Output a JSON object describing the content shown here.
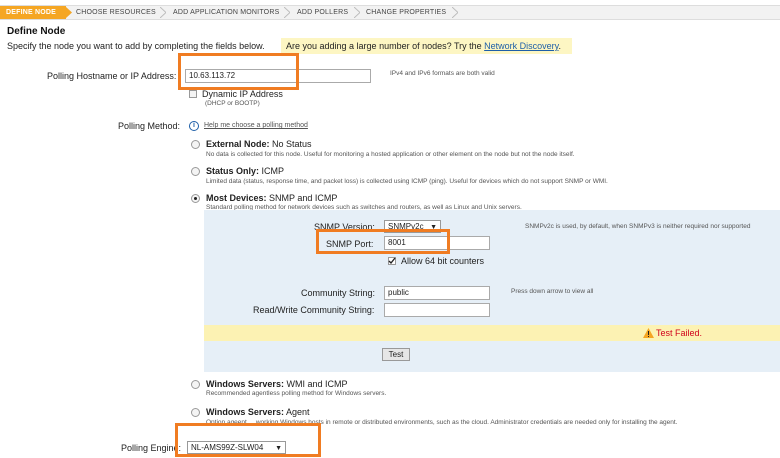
{
  "wizard": {
    "steps": [
      "DEFINE NODE",
      "CHOOSE RESOURCES",
      "ADD APPLICATION MONITORS",
      "ADD POLLERS",
      "CHANGE PROPERTIES"
    ]
  },
  "page": {
    "title": "Define Node",
    "intro": "Specify the node you want to add by completing the fields below.",
    "question": "Are you adding a large number of nodes? Try the",
    "question_link": "Network Discovery",
    "question_end": "."
  },
  "hostname": {
    "label": "Polling Hostname or IP Address:",
    "value": "10.63.113.72",
    "hint": "IPv4 and IPv6 formats are both valid",
    "dynamic_label": "Dynamic IP Address",
    "dynamic_sub": "(DHCP or BOOTP)"
  },
  "polling_method": {
    "label": "Polling Method:",
    "help_link": "Help me choose a polling method",
    "options": [
      {
        "title_bold": "External Node:",
        "title_rest": " No Status",
        "desc": "No data is collected for this node. Useful for monitoring a hosted application or other element on the node but not the node itself."
      },
      {
        "title_bold": "Status Only:",
        "title_rest": " ICMP",
        "desc": "Limited data (status, response time, and packet loss) is collected using ICMP (ping). Useful for devices which do not support SNMP or WMI."
      },
      {
        "title_bold": "Most Devices:",
        "title_rest": " SNMP and ICMP",
        "desc": "Standard polling method for network devices such as switches and routers, as well as Linux and Unix servers."
      },
      {
        "title_bold": "Windows Servers:",
        "title_rest": " WMI and ICMP",
        "desc": "Recommended agentless polling method for Windows servers."
      },
      {
        "title_bold": "Windows Servers:",
        "title_rest": " Agent",
        "desc": "Option ageent ... working Windows hosts in remote or distributed environments, such as the cloud. Administrator credentials are needed only for installing the agent."
      }
    ]
  },
  "snmp": {
    "version_label": "SNMP Version:",
    "version_value": "SNMPv2c",
    "version_hint": "SNMPv2c is used, by default, when SNMPv3 is neither required nor supported",
    "port_label": "SNMP Port:",
    "port_value": "8001",
    "counters_label": "Allow 64 bit counters",
    "community_label": "Community String:",
    "community_value": "public",
    "community_hint": "Press down arrow to view all",
    "rw_label": "Read/Write Community String:",
    "rw_value": "",
    "test_failed": "Test Failed.",
    "test_button": "Test"
  },
  "engine": {
    "label": "Polling Engine:",
    "value": "NL-AMS99Z-SLW04"
  },
  "colors": {
    "accent_orange": "#f07c22",
    "wizard_active": "#f5a623",
    "link_blue": "#1e5fa8",
    "panel_blue": "#e6eff7",
    "warn_yellow": "#fcf2b3",
    "error_red": "#d0021b"
  },
  "icons": [
    "chevron-right-icon",
    "info-icon",
    "warning-icon",
    "checkbox-checked-icon",
    "dropdown-arrow-icon"
  ]
}
